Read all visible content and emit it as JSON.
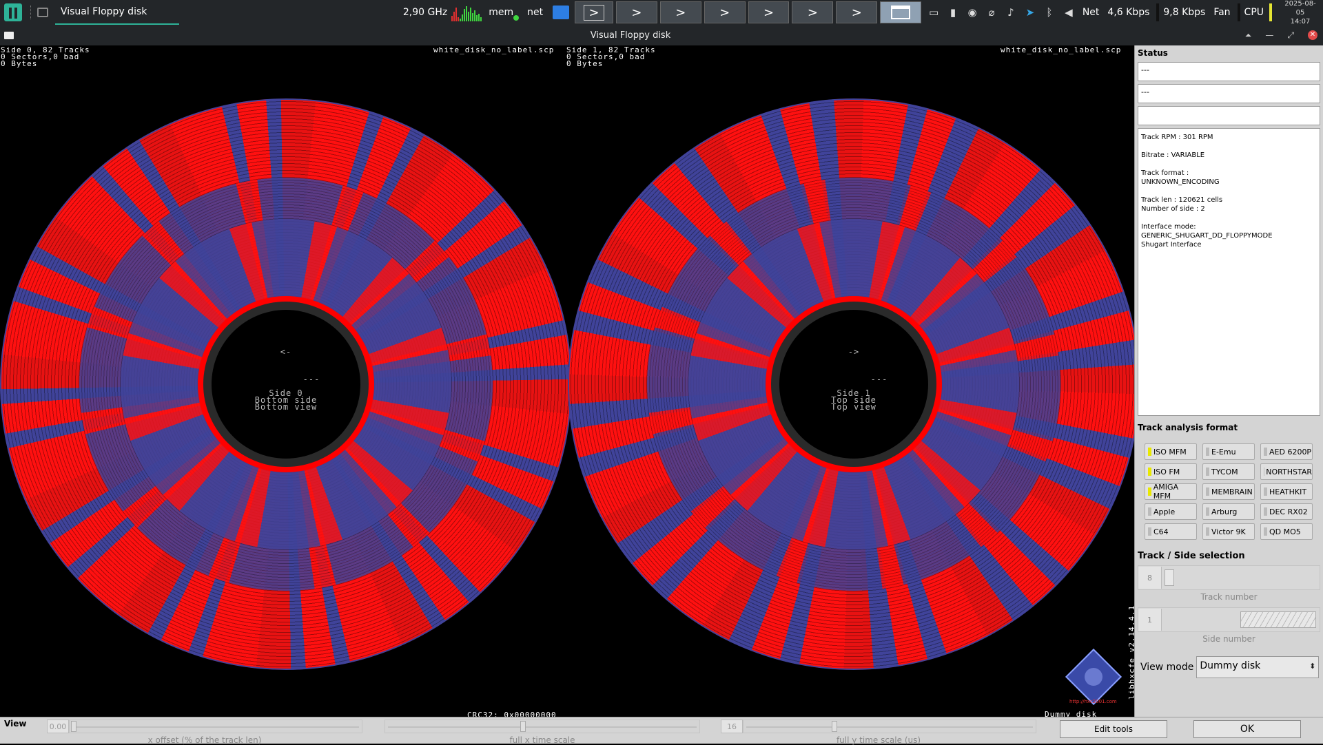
{
  "taskbar": {
    "task_title": "Visual Floppy disk",
    "cpu_freq": "2,90 GHz",
    "mem_label": "mem",
    "net_label": "net",
    "desktop_arrow": ">",
    "net_text": "Net",
    "net_down": "4,6 Kbps",
    "net_up": "9,8 Kbps",
    "fan_label": "Fan",
    "cpu_label": "CPU",
    "date": "2025-08-05",
    "time": "14:07",
    "icons": [
      "screen-icon",
      "usb-icon",
      "shield-icon",
      "clip-icon",
      "mic-icon",
      "telegram-icon",
      "bluetooth-icon",
      "volume-icon"
    ]
  },
  "window": {
    "title": "Visual Floppy disk",
    "controls": [
      "shade",
      "minimize",
      "maximize",
      "close"
    ]
  },
  "diskview": {
    "side0_info": "Side 0, 82 Tracks\n0 Sectors,0 bad\n0 Bytes",
    "side1_info": "Side 1, 82 Tracks\n0 Sectors,0 bad\n0 Bytes",
    "file_name_left": "white_disk_no_label.scp",
    "file_name_right": "white_disk_no_label.scp",
    "side0_hub": "<-\n\n\n\n         ---\n\nSide 0\nBottom side\nBottom view",
    "side1_hub": "->\n\n\n\n         ---\n\nSide 1\nTop side\nTop view",
    "crc": "CRC32: 0x00000000",
    "dummy_label": "Dummy disk",
    "lib_version": "libhxcfe v2.14.4.1",
    "logo_url": "http://hxc2001.com",
    "colors": {
      "track_red": "#ff1010",
      "track_blue": "#40439a",
      "hub": "#000000"
    }
  },
  "panel": {
    "status_title": "Status",
    "status_field_1": "---",
    "status_field_2": "---",
    "status_field_3": "",
    "status_text": "Track RPM : 301 RPM\n\nBitrate : VARIABLE\n\nTrack format :\nUNKNOWN_ENCODING\n\nTrack len : 120621 cells\nNumber of side : 2\n\nInterface mode:\nGENERIC_SHUGART_DD_FLOPPYMODE\nShugart Interface",
    "track_analysis_title": "Track analysis format",
    "formats": [
      {
        "label": "ISO MFM",
        "on": true
      },
      {
        "label": "E-Emu",
        "on": false
      },
      {
        "label": "AED 6200P",
        "on": false
      },
      {
        "label": "ISO FM",
        "on": true
      },
      {
        "label": "TYCOM",
        "on": false
      },
      {
        "label": "NORTHSTAR",
        "on": false
      },
      {
        "label": "AMIGA MFM",
        "on": true
      },
      {
        "label": "MEMBRAIN",
        "on": false
      },
      {
        "label": "HEATHKIT",
        "on": false
      },
      {
        "label": "Apple",
        "on": false
      },
      {
        "label": "Arburg",
        "on": false
      },
      {
        "label": "DEC RX02",
        "on": false
      },
      {
        "label": "C64",
        "on": false
      },
      {
        "label": "Victor 9K",
        "on": false
      },
      {
        "label": "QD MO5",
        "on": false
      }
    ],
    "track_side_title": "Track / Side selection",
    "track_number_value": "8",
    "track_number_caption": "Track number",
    "side_number_value": "1",
    "side_number_caption": "Side number",
    "view_mode_label": "View mode",
    "view_mode_value": "Dummy disk"
  },
  "bottom": {
    "view_label": "View",
    "x_offset_value": "0.00",
    "x_offset_caption": "x offset (% of the track len)",
    "x_scale_caption": "full x time scale",
    "y_scale_value": "16",
    "y_scale_caption": "full y time scale (us)",
    "edit_tools_label": "Edit tools",
    "ok_label": "OK"
  }
}
